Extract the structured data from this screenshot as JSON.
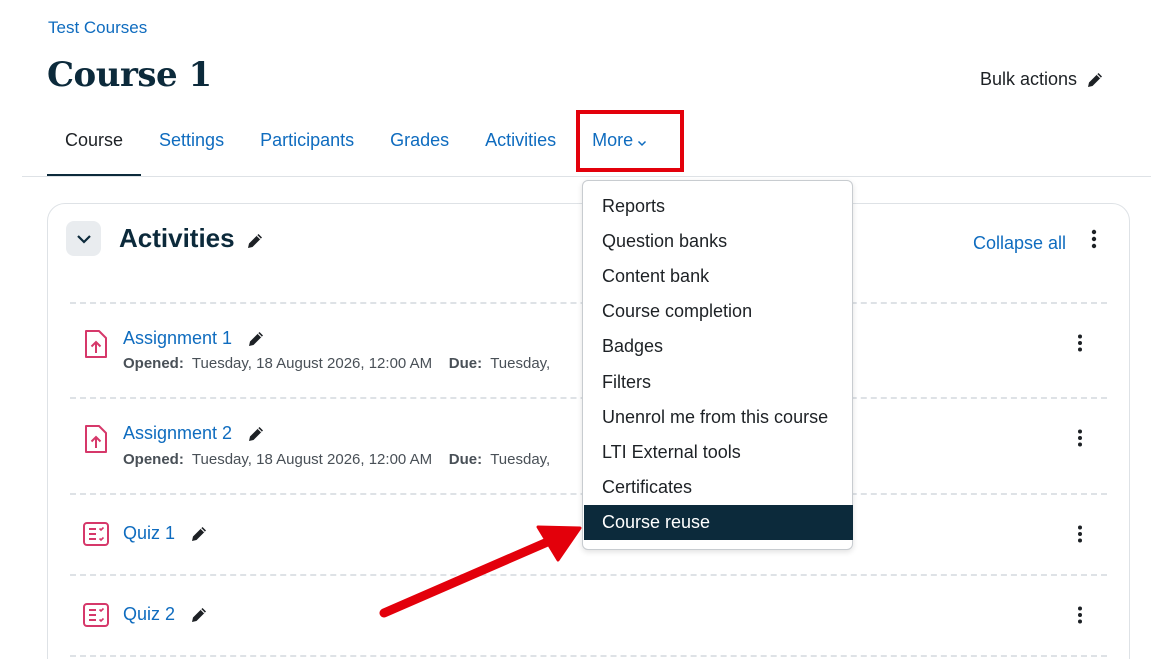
{
  "breadcrumb": "Test Courses",
  "page_title": "Course 1",
  "bulk_actions": "Bulk actions",
  "tabs": [
    {
      "label": "Course"
    },
    {
      "label": "Settings"
    },
    {
      "label": "Participants"
    },
    {
      "label": "Grades"
    },
    {
      "label": "Activities"
    },
    {
      "label": "More"
    }
  ],
  "section": {
    "title": "Activities",
    "collapse_all": "Collapse all"
  },
  "activities": [
    {
      "name": "Assignment 1",
      "opened_label": "Opened:",
      "opened_value": "Tuesday, 18 August 2026, 12:00 AM",
      "due_label": "Due:",
      "due_value": "Tuesday,"
    },
    {
      "name": "Assignment 2",
      "opened_label": "Opened:",
      "opened_value": "Tuesday, 18 August 2026, 12:00 AM",
      "due_label": "Due:",
      "due_value": "Tuesday,"
    },
    {
      "name": "Quiz 1"
    },
    {
      "name": "Quiz 2"
    }
  ],
  "more_menu": {
    "items": [
      {
        "label": "Reports"
      },
      {
        "label": "Question banks"
      },
      {
        "label": "Content bank"
      },
      {
        "label": "Course completion"
      },
      {
        "label": "Badges"
      },
      {
        "label": "Filters"
      },
      {
        "label": "Unenrol me from this course"
      },
      {
        "label": "LTI External tools"
      },
      {
        "label": "Certificates"
      },
      {
        "label": "Course reuse"
      }
    ],
    "selected": "Course reuse"
  },
  "colors": {
    "link": "#0f6cbf",
    "dark": "#0c2a3b",
    "activity_icon": "#d6386a",
    "highlight": "#e3000b"
  }
}
